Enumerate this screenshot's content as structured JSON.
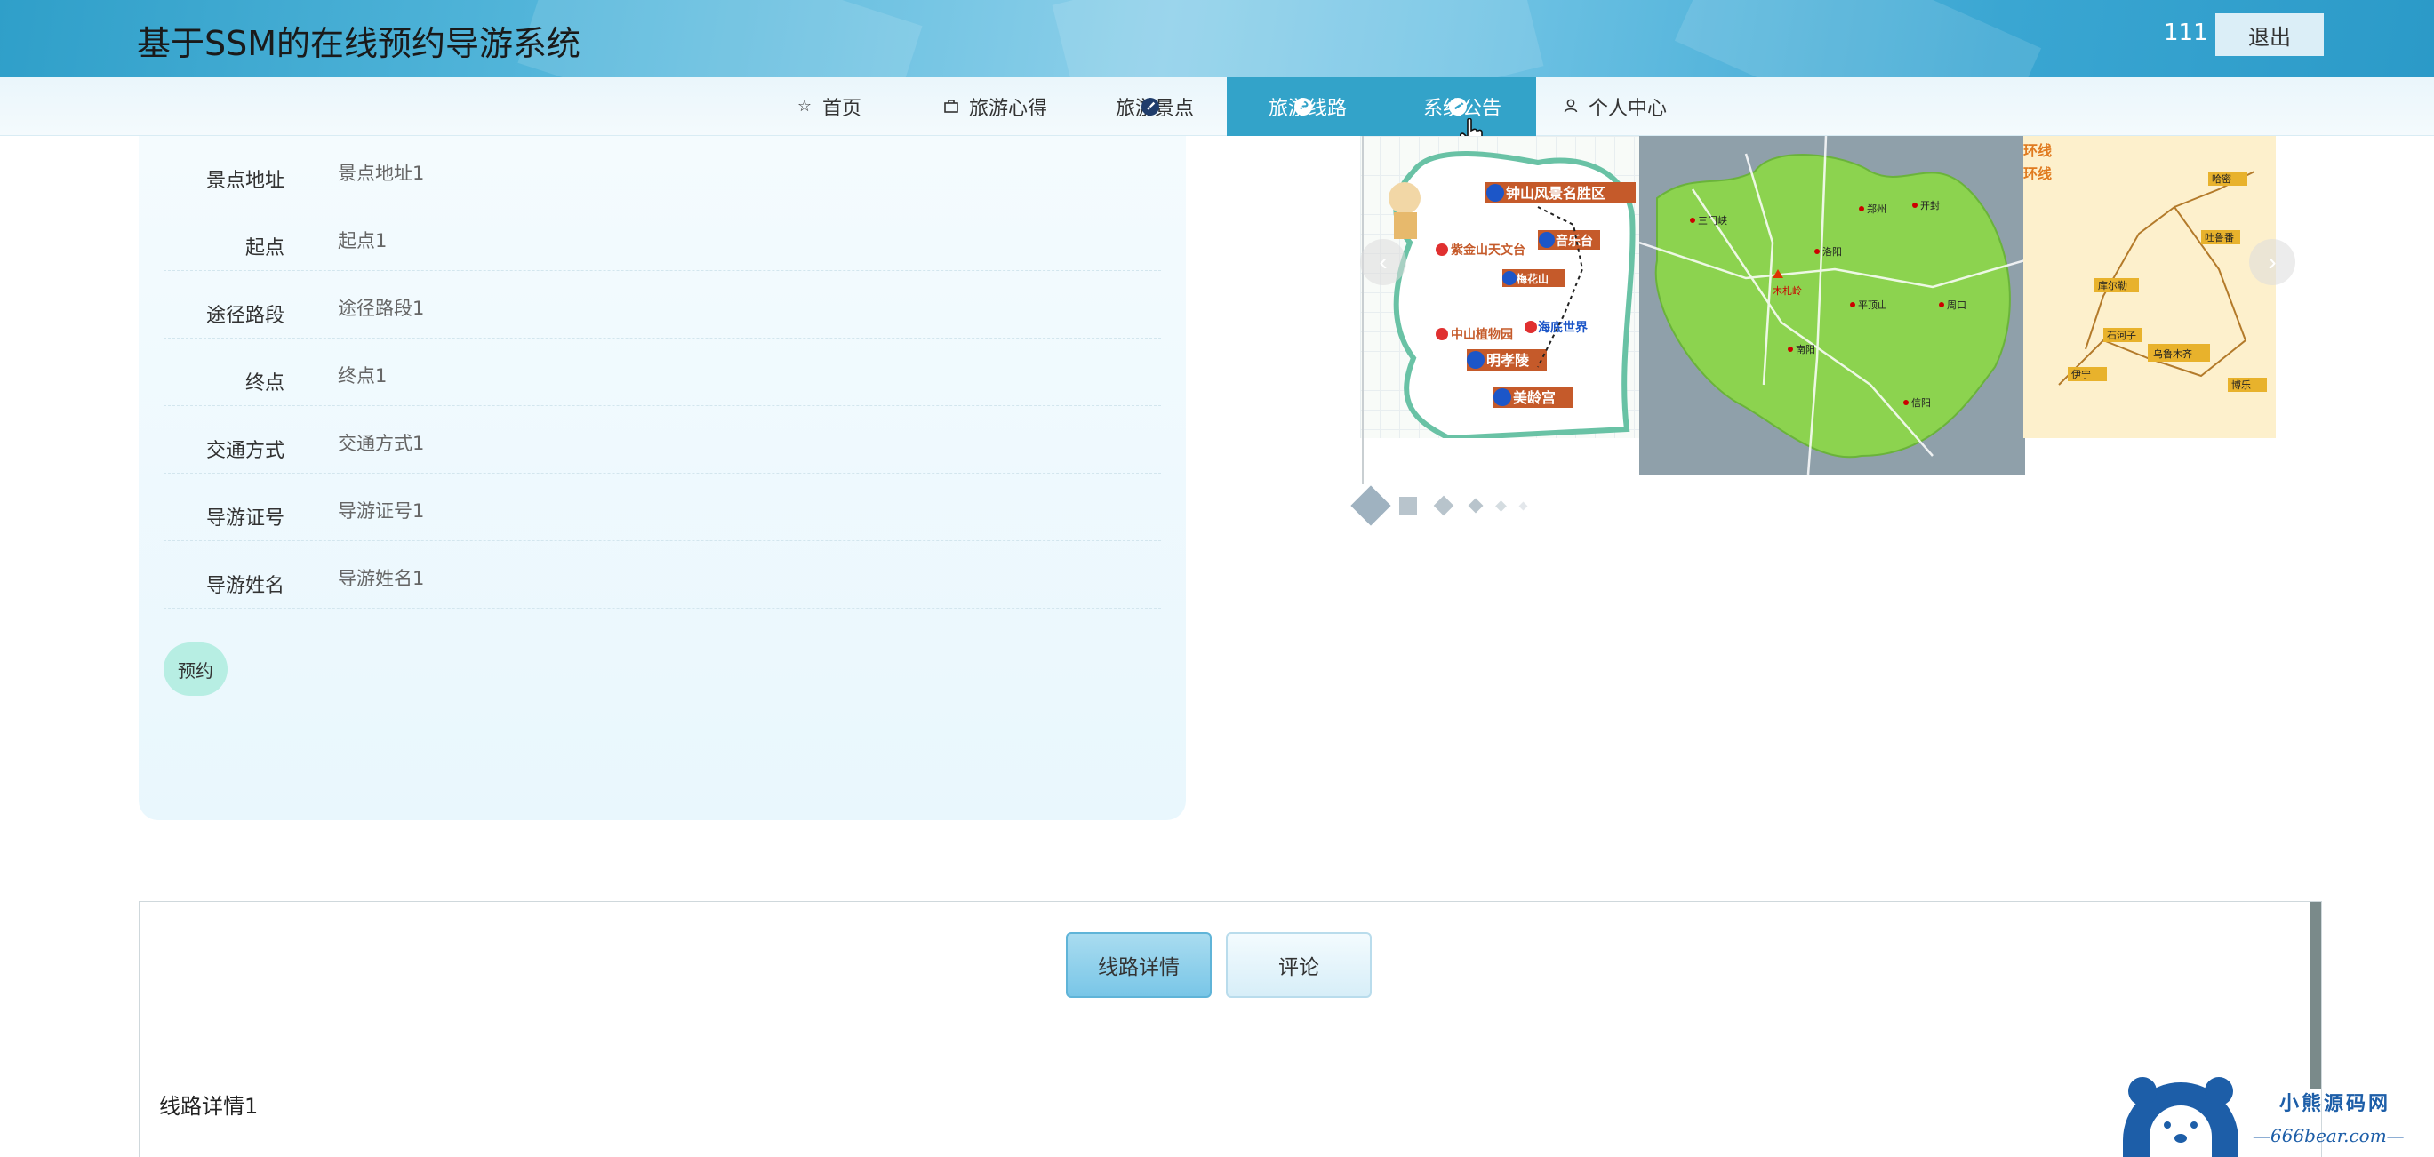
{
  "header": {
    "site_title": "基于SSM的在线预约导游系统",
    "username": "111",
    "logout_label": "退出"
  },
  "nav": {
    "items": [
      {
        "label": "首页",
        "icon": "star-icon",
        "active": false
      },
      {
        "label": "旅游心得",
        "icon": "bag-icon",
        "active": false
      },
      {
        "label": "旅游景点",
        "icon": "info-icon",
        "active": false
      },
      {
        "label": "旅游线路",
        "icon": "question-icon",
        "active": true
      },
      {
        "label": "系统公告",
        "icon": "info-italic-icon",
        "active": false
      },
      {
        "label": "个人中心",
        "icon": "user-icon",
        "active": false
      }
    ]
  },
  "route_info": {
    "rows": [
      {
        "label": "景点地址",
        "value": "景点地址1"
      },
      {
        "label": "起点",
        "value": "起点1"
      },
      {
        "label": "途径路段",
        "value": "途径路段1"
      },
      {
        "label": "终点",
        "value": "终点1"
      },
      {
        "label": "交通方式",
        "value": "交通方式1"
      },
      {
        "label": "导游证号",
        "value": "导游证号1"
      },
      {
        "label": "导游姓名",
        "value": "导游姓名1"
      }
    ],
    "book_label": "预约"
  },
  "carousel": {
    "prev_icon": "chevron-left-icon",
    "next_icon": "chevron-right-icon",
    "slide_count": 6,
    "active_index": 0,
    "map1_labels": [
      "钟山风景名胜区",
      "音乐台",
      "梅花山",
      "中山植物园",
      "海底世界",
      "明孝陵",
      "紫金山天文台",
      "美龄宫"
    ],
    "map2_labels": [
      "三门峡",
      "木札岭",
      "郑州",
      "洛阳",
      "开封",
      "南阳",
      "周口",
      "信阳",
      "平顶山"
    ],
    "map3_labels": [
      "环线",
      "环线",
      "乌鲁木齐",
      "吐鲁番",
      "哈密",
      "库尔勒",
      "伊宁",
      "石河子",
      "博乐"
    ]
  },
  "tabs": {
    "items": [
      {
        "label": "线路详情",
        "active": true
      },
      {
        "label": "评论",
        "active": false
      }
    ],
    "content": "线路详情1"
  },
  "watermark": {
    "brand": "小熊源码网",
    "url": "—666bear.com—"
  },
  "colors": {
    "header_accent": "#33a3c9",
    "nav_active_bg": "#33a3c9",
    "book_button": "#b7eee3",
    "panel_bg": "#e9f7fd"
  }
}
